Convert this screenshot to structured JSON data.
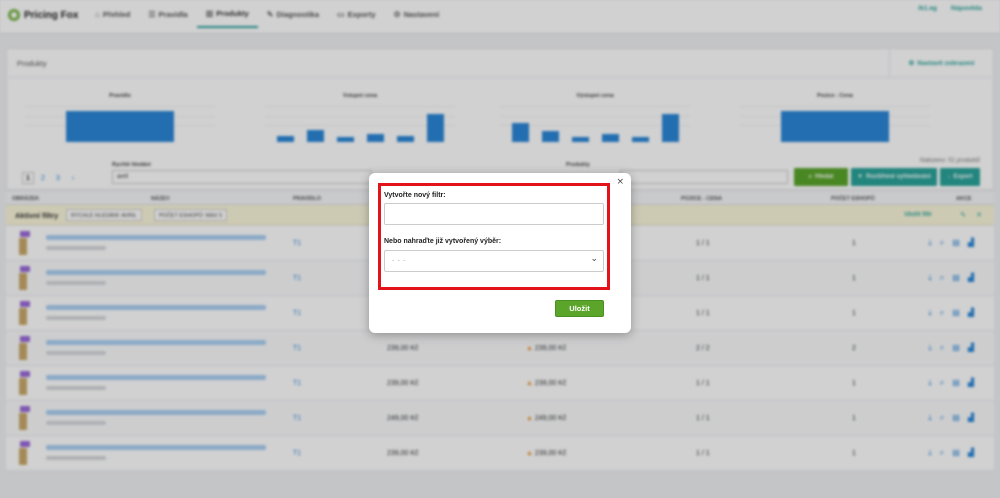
{
  "app": {
    "brand": "Pricing Fox",
    "nav": [
      {
        "label": "Přehled",
        "icon": "home-icon",
        "glyph": "⌂"
      },
      {
        "label": "Pravidla",
        "icon": "rules-icon",
        "glyph": "☰"
      },
      {
        "label": "Produkty",
        "icon": "chart-icon",
        "glyph": "▥"
      },
      {
        "label": "Diagnostika",
        "icon": "diagnostic-icon",
        "glyph": "✎"
      },
      {
        "label": "Exporty",
        "icon": "export-icon",
        "glyph": "▭"
      },
      {
        "label": "Nastavení",
        "icon": "settings-icon",
        "glyph": "⚙"
      }
    ],
    "top_right": [
      "/b1.eg",
      "Nápověda"
    ]
  },
  "panel": {
    "title": "Produkty",
    "view_settings": "Nastavit zobrazení",
    "mini_charts": [
      {
        "title": "Pravidlo",
        "values": [
          1
        ]
      },
      {
        "title": "Vstupní cena",
        "values": [
          0.2,
          0.4,
          0.15,
          0.25,
          0.2,
          0.9
        ]
      },
      {
        "title": "Výstupní cena",
        "values": [
          0.6,
          0.35,
          0.15,
          0.25,
          0.15,
          0.9
        ]
      },
      {
        "title": "Pozice - Cena",
        "values": [
          1
        ]
      }
    ],
    "pages": [
      "1",
      "2",
      "3",
      "›"
    ],
    "quick_search_label": "Rychlé hledání",
    "quick_search_value": "avril",
    "products_label": "Produkty",
    "found": "Nalezeno: 51 produktů",
    "search_btn": "Hledat",
    "advanced_btn": "Rozšířené vyhledávání",
    "export_btn": "Export"
  },
  "table": {
    "headers": [
      "OBRÁZEK",
      "NÁZEV",
      "PRAVIDLO",
      "POZICE - CENA",
      "POČET ESHOPŮ",
      "AKCE"
    ],
    "filters_title": "Aktivní filtry",
    "chips": [
      "RYCHLÉ HLEDÁNÍ: AVRIL",
      "POČET ESHOPŮ: MAX 5"
    ],
    "save_filter": "Uložit filtr",
    "rows": [
      {
        "rule": "T1",
        "in": "",
        "out": "",
        "pos": "1 / 1",
        "shops": "1"
      },
      {
        "rule": "T1",
        "in": "",
        "out": "",
        "pos": "1 / 1",
        "shops": "1"
      },
      {
        "rule": "T1",
        "in": "",
        "out": "",
        "pos": "1 / 1",
        "shops": "1"
      },
      {
        "rule": "T1",
        "in": "239,00 Kč",
        "out": "239,00 Kč",
        "pos": "2 / 2",
        "shops": "2"
      },
      {
        "rule": "T1",
        "in": "239,00 Kč",
        "out": "239,00 Kč",
        "pos": "1 / 1",
        "shops": "1"
      },
      {
        "rule": "T1",
        "in": "249,00 Kč",
        "out": "249,00 Kč",
        "pos": "1 / 1",
        "shops": "1"
      },
      {
        "rule": "T1",
        "in": "239,00 Kč",
        "out": "239,00 Kč",
        "pos": "1 / 1",
        "shops": "1"
      }
    ]
  },
  "modal": {
    "close": "×",
    "new_filter_label": "Vytvořte nový filtr:",
    "new_filter_value": "",
    "replace_label": "Nebo nahraďte již vytvořený výběr:",
    "replace_selected": "- - -",
    "save": "Uložit"
  }
}
